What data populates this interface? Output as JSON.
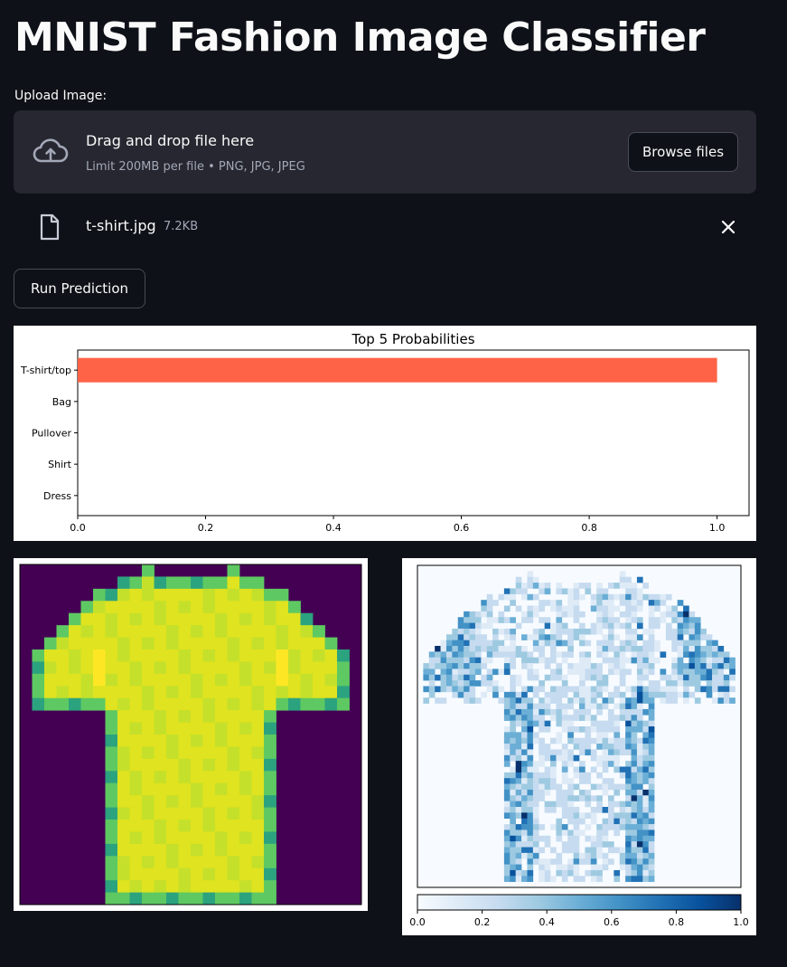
{
  "title": "MNIST Fashion Image Classifier",
  "uploader": {
    "label": "Upload Image:",
    "drop_text": "Drag and drop file here",
    "limit_text": "Limit 200MB per file • PNG, JPG, JPEG",
    "browse_label": "Browse files",
    "icon": "cloud-upload-icon"
  },
  "file": {
    "name": "t-shirt.jpg",
    "size": "7.2KB",
    "icon": "file-icon",
    "remove_icon": "close-icon"
  },
  "run_button_label": "Run Prediction",
  "chart_data": [
    {
      "type": "bar",
      "orientation": "horizontal",
      "title": "Top 5 Probabilities",
      "categories": [
        "T-shirt/top",
        "Bag",
        "Pullover",
        "Shirt",
        "Dress"
      ],
      "values": [
        1.0,
        0.0,
        0.0,
        0.0,
        0.0
      ],
      "xticks": [
        "0.0",
        "0.2",
        "0.4",
        "0.6",
        "0.8",
        "1.0"
      ],
      "xlim": [
        0,
        1.05
      ],
      "bar_color": "#ff6347"
    },
    {
      "type": "heatmap",
      "colormap": "Blues",
      "colorbar_ticks": [
        "0.0",
        "0.2",
        "0.4",
        "0.6",
        "0.8",
        "1.0"
      ],
      "colorbar_range": [
        0,
        1
      ]
    }
  ],
  "colors": {
    "background": "#0e1117",
    "dropzone": "#262730",
    "text": "#fafafa",
    "muted_text": "#a3a8b8",
    "border": "#4a4c55"
  }
}
